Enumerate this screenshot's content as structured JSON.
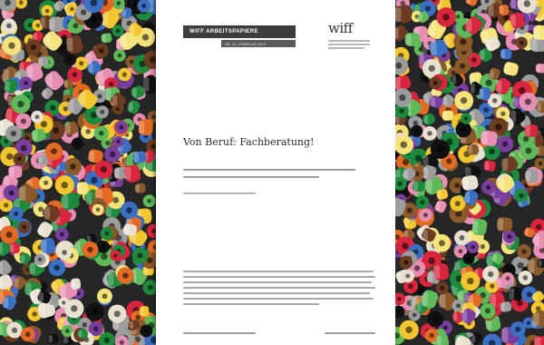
{
  "document": {
    "series_label": "WIFF ARBEITSPAPIERE",
    "series_sub": "NR. 30 | FEBRUAR 2023",
    "logo_text": "wiff",
    "title": "Von Beruf: Fachberatung!"
  },
  "colors": {
    "bead_palette": [
      "#1e8a3e",
      "#f2c62f",
      "#e36a24",
      "#d7263d",
      "#7a3e9d",
      "#e78fb3",
      "#3b6fc1",
      "#e8e1d2",
      "#8b5a2b",
      "#111111",
      "#5fb85a",
      "#f4e37a",
      "#9c9c9c",
      "#6b3b22"
    ],
    "doc_background": "#ffffff",
    "series_bar": "#3c3c3c"
  }
}
